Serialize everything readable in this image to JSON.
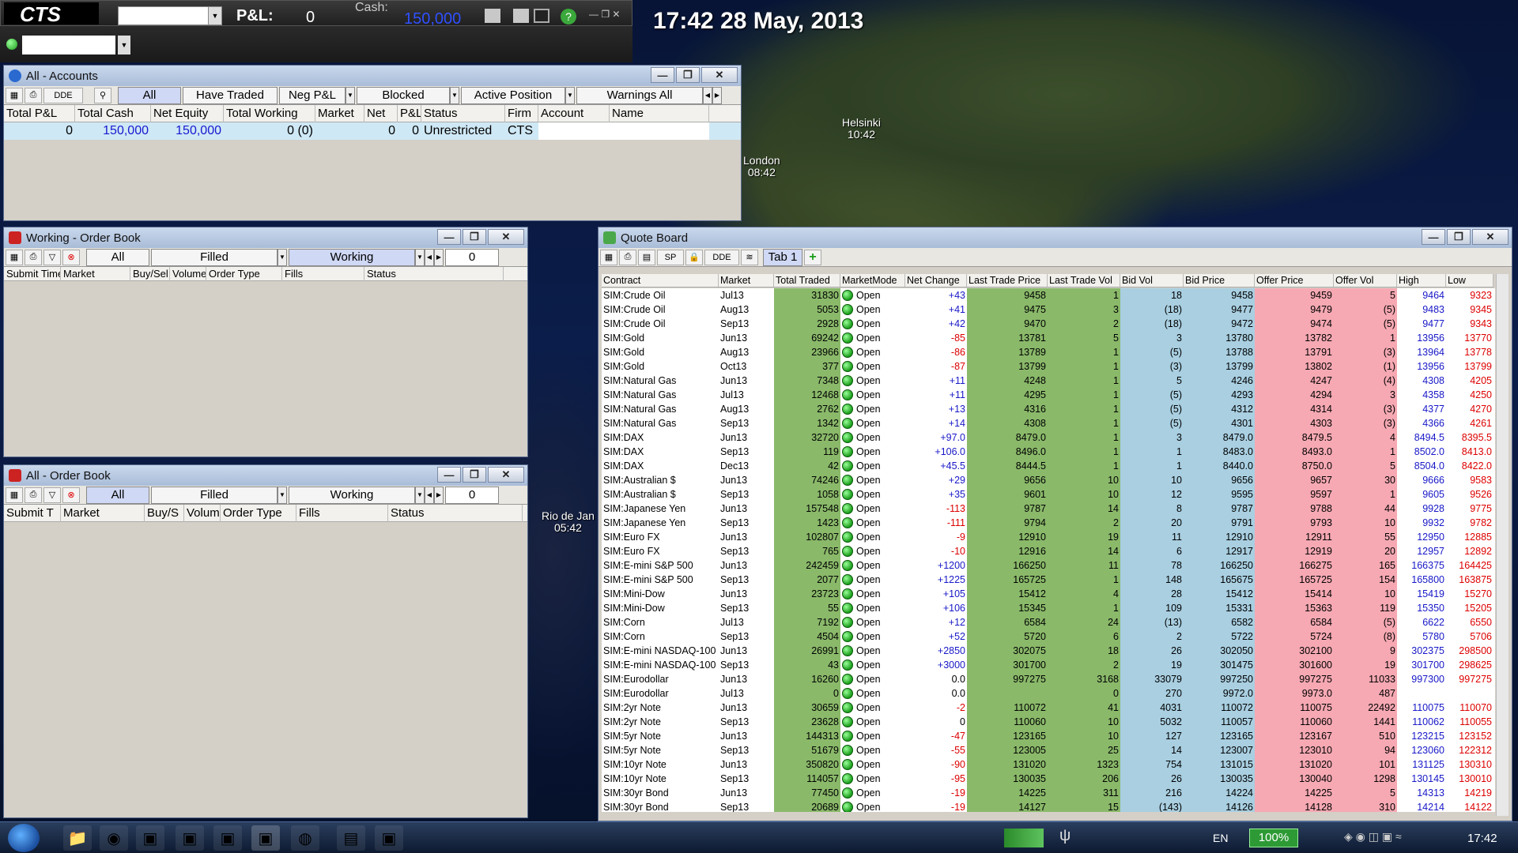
{
  "clock": "17:42 28 May, 2013",
  "cities": [
    {
      "name": "Helsinki",
      "time": "10:42"
    },
    {
      "name": "London",
      "time": "08:42"
    },
    {
      "name": "Rio de Jan",
      "time": "05:42"
    }
  ],
  "topbar": {
    "logo": "CTS",
    "pl_label": "P&L:",
    "pl_value": "0",
    "cash_label": "Cash:",
    "cash_value": "150,000"
  },
  "accounts": {
    "title": "All - Accounts",
    "dde": "DDE",
    "tabs": [
      "All",
      "Have Traded",
      "Neg P&L",
      "Blocked",
      "Active Position",
      "Warnings All"
    ],
    "columns": [
      "Total P&L",
      "Total Cash",
      "Net Equity",
      "Total Working",
      "Market",
      "Net",
      "P&L",
      "Status",
      "Firm",
      "Account",
      "Name"
    ],
    "row": {
      "total_pl": "0",
      "total_cash": "150,000",
      "net_equity": "150,000",
      "total_working": "0 (0)",
      "net": "0",
      "pl": "0",
      "status": "Unrestricted",
      "firm": "CTS"
    }
  },
  "working_ob": {
    "title": "Working - Order Book",
    "tabs": [
      "All",
      "Filled",
      "Working"
    ],
    "count": "0",
    "columns": [
      "Submit Time",
      "Market",
      "Buy/Sel",
      "Volume",
      "Order Type",
      "Fills",
      "Status"
    ]
  },
  "all_ob": {
    "title": "All - Order Book",
    "tabs": [
      "All",
      "Filled",
      "Working"
    ],
    "count": "0",
    "columns": [
      "Submit T",
      "Market",
      "Buy/S",
      "Volum",
      "Order Type",
      "Fills",
      "Status"
    ]
  },
  "quote": {
    "title": "Quote Board",
    "sp": "SP",
    "dde": "DDE",
    "tab": "Tab 1",
    "columns": [
      "Contract",
      "Market",
      "Total Traded",
      "MarketMode",
      "Net Change",
      "Last Trade Price",
      "Last Trade Vol",
      "Bid Vol",
      "Bid Price",
      "Offer Price",
      "Offer Vol",
      "High",
      "Low"
    ],
    "rows": [
      [
        "SIM:Crude Oil",
        "Jul13",
        "31830",
        "Open",
        "+43",
        "9458",
        "1",
        "18",
        "9458",
        "9459",
        "5",
        "9464",
        "9323"
      ],
      [
        "SIM:Crude Oil",
        "Aug13",
        "5053",
        "Open",
        "+41",
        "9475",
        "3",
        "(18)",
        "9477",
        "9479",
        "(5)",
        "9483",
        "9345"
      ],
      [
        "SIM:Crude Oil",
        "Sep13",
        "2928",
        "Open",
        "+42",
        "9470",
        "2",
        "(18)",
        "9472",
        "9474",
        "(5)",
        "9477",
        "9343"
      ],
      [
        "SIM:Gold",
        "Jun13",
        "69242",
        "Open",
        "-85",
        "13781",
        "5",
        "3",
        "13780",
        "13782",
        "1",
        "13956",
        "13770"
      ],
      [
        "SIM:Gold",
        "Aug13",
        "23966",
        "Open",
        "-86",
        "13789",
        "1",
        "(5)",
        "13788",
        "13791",
        "(3)",
        "13964",
        "13778"
      ],
      [
        "SIM:Gold",
        "Oct13",
        "377",
        "Open",
        "-87",
        "13799",
        "1",
        "(3)",
        "13799",
        "13802",
        "(1)",
        "13956",
        "13799"
      ],
      [
        "SIM:Natural Gas",
        "Jun13",
        "7348",
        "Open",
        "+11",
        "4248",
        "1",
        "5",
        "4246",
        "4247",
        "(4)",
        "4308",
        "4205"
      ],
      [
        "SIM:Natural Gas",
        "Jul13",
        "12468",
        "Open",
        "+11",
        "4295",
        "1",
        "(5)",
        "4293",
        "4294",
        "3",
        "4358",
        "4250"
      ],
      [
        "SIM:Natural Gas",
        "Aug13",
        "2762",
        "Open",
        "+13",
        "4316",
        "1",
        "(5)",
        "4312",
        "4314",
        "(3)",
        "4377",
        "4270"
      ],
      [
        "SIM:Natural Gas",
        "Sep13",
        "1342",
        "Open",
        "+14",
        "4308",
        "1",
        "(5)",
        "4301",
        "4303",
        "(3)",
        "4366",
        "4261"
      ],
      [
        "SIM:DAX",
        "Jun13",
        "32720",
        "Open",
        "+97.0",
        "8479.0",
        "1",
        "3",
        "8479.0",
        "8479.5",
        "4",
        "8494.5",
        "8395.5"
      ],
      [
        "SIM:DAX",
        "Sep13",
        "119",
        "Open",
        "+106.0",
        "8496.0",
        "1",
        "1",
        "8483.0",
        "8493.0",
        "1",
        "8502.0",
        "8413.0"
      ],
      [
        "SIM:DAX",
        "Dec13",
        "42",
        "Open",
        "+45.5",
        "8444.5",
        "1",
        "1",
        "8440.0",
        "8750.0",
        "5",
        "8504.0",
        "8422.0"
      ],
      [
        "SIM:Australian $",
        "Jun13",
        "74246",
        "Open",
        "+29",
        "9656",
        "10",
        "10",
        "9656",
        "9657",
        "30",
        "9666",
        "9583"
      ],
      [
        "SIM:Australian $",
        "Sep13",
        "1058",
        "Open",
        "+35",
        "9601",
        "10",
        "12",
        "9595",
        "9597",
        "1",
        "9605",
        "9526"
      ],
      [
        "SIM:Japanese Yen",
        "Jun13",
        "157548",
        "Open",
        "-113",
        "9787",
        "14",
        "8",
        "9787",
        "9788",
        "44",
        "9928",
        "9775"
      ],
      [
        "SIM:Japanese Yen",
        "Sep13",
        "1423",
        "Open",
        "-111",
        "9794",
        "2",
        "20",
        "9791",
        "9793",
        "10",
        "9932",
        "9782"
      ],
      [
        "SIM:Euro FX",
        "Jun13",
        "102807",
        "Open",
        "-9",
        "12910",
        "19",
        "11",
        "12910",
        "12911",
        "55",
        "12950",
        "12885"
      ],
      [
        "SIM:Euro FX",
        "Sep13",
        "765",
        "Open",
        "-10",
        "12916",
        "14",
        "6",
        "12917",
        "12919",
        "20",
        "12957",
        "12892"
      ],
      [
        "SIM:E-mini S&P 500",
        "Jun13",
        "242459",
        "Open",
        "+1200",
        "166250",
        "11",
        "78",
        "166250",
        "166275",
        "165",
        "166375",
        "164425"
      ],
      [
        "SIM:E-mini S&P 500",
        "Sep13",
        "2077",
        "Open",
        "+1225",
        "165725",
        "1",
        "148",
        "165675",
        "165725",
        "154",
        "165800",
        "163875"
      ],
      [
        "SIM:Mini-Dow",
        "Jun13",
        "23723",
        "Open",
        "+105",
        "15412",
        "4",
        "28",
        "15412",
        "15414",
        "10",
        "15419",
        "15270"
      ],
      [
        "SIM:Mini-Dow",
        "Sep13",
        "55",
        "Open",
        "+106",
        "15345",
        "1",
        "109",
        "15331",
        "15363",
        "119",
        "15350",
        "15205"
      ],
      [
        "SIM:Corn",
        "Jul13",
        "7192",
        "Open",
        "+12",
        "6584",
        "24",
        "(13)",
        "6582",
        "6584",
        "(5)",
        "6622",
        "6550"
      ],
      [
        "SIM:Corn",
        "Sep13",
        "4504",
        "Open",
        "+52",
        "5720",
        "6",
        "2",
        "5722",
        "5724",
        "(8)",
        "5780",
        "5706"
      ],
      [
        "SIM:E-mini NASDAQ-100",
        "Jun13",
        "26991",
        "Open",
        "+2850",
        "302075",
        "18",
        "26",
        "302050",
        "302100",
        "9",
        "302375",
        "298500"
      ],
      [
        "SIM:E-mini NASDAQ-100",
        "Sep13",
        "43",
        "Open",
        "+3000",
        "301700",
        "2",
        "19",
        "301475",
        "301600",
        "19",
        "301700",
        "298625"
      ],
      [
        "SIM:Eurodollar",
        "Jun13",
        "16260",
        "Open",
        "0.0",
        "997275",
        "3168",
        "33079",
        "997250",
        "997275",
        "11033",
        "997300",
        "997275"
      ],
      [
        "SIM:Eurodollar",
        "Jul13",
        "0",
        "Open",
        "0.0",
        "",
        "0",
        "270",
        "9972.0",
        "9973.0",
        "487",
        "",
        ""
      ],
      [
        "SIM:2yr Note",
        "Jun13",
        "30659",
        "Open",
        "-2",
        "110072",
        "41",
        "4031",
        "110072",
        "110075",
        "22492",
        "110075",
        "110070"
      ],
      [
        "SIM:2yr Note",
        "Sep13",
        "23628",
        "Open",
        "0",
        "110060",
        "10",
        "5032",
        "110057",
        "110060",
        "1441",
        "110062",
        "110055"
      ],
      [
        "SIM:5yr Note",
        "Jun13",
        "144313",
        "Open",
        "-47",
        "123165",
        "10",
        "127",
        "123165",
        "123167",
        "510",
        "123215",
        "123152"
      ],
      [
        "SIM:5yr Note",
        "Sep13",
        "51679",
        "Open",
        "-55",
        "123005",
        "25",
        "14",
        "123007",
        "123010",
        "94",
        "123060",
        "122312"
      ],
      [
        "SIM:10yr Note",
        "Jun13",
        "350820",
        "Open",
        "-90",
        "131020",
        "1323",
        "754",
        "131015",
        "131020",
        "101",
        "131125",
        "130310"
      ],
      [
        "SIM:10yr Note",
        "Sep13",
        "114057",
        "Open",
        "-95",
        "130035",
        "206",
        "26",
        "130035",
        "130040",
        "1298",
        "130145",
        "130010"
      ],
      [
        "SIM:30yr Bond",
        "Jun13",
        "77450",
        "Open",
        "-19",
        "14225",
        "311",
        "216",
        "14224",
        "14225",
        "5",
        "14313",
        "14219"
      ],
      [
        "SIM:30yr Bond",
        "Sep13",
        "20689",
        "Open",
        "-19",
        "14127",
        "15",
        "(143)",
        "14126",
        "14128",
        "310",
        "14214",
        "14122"
      ]
    ]
  },
  "tray": {
    "lang": "EN",
    "battery": "100%",
    "time": "17:42"
  }
}
